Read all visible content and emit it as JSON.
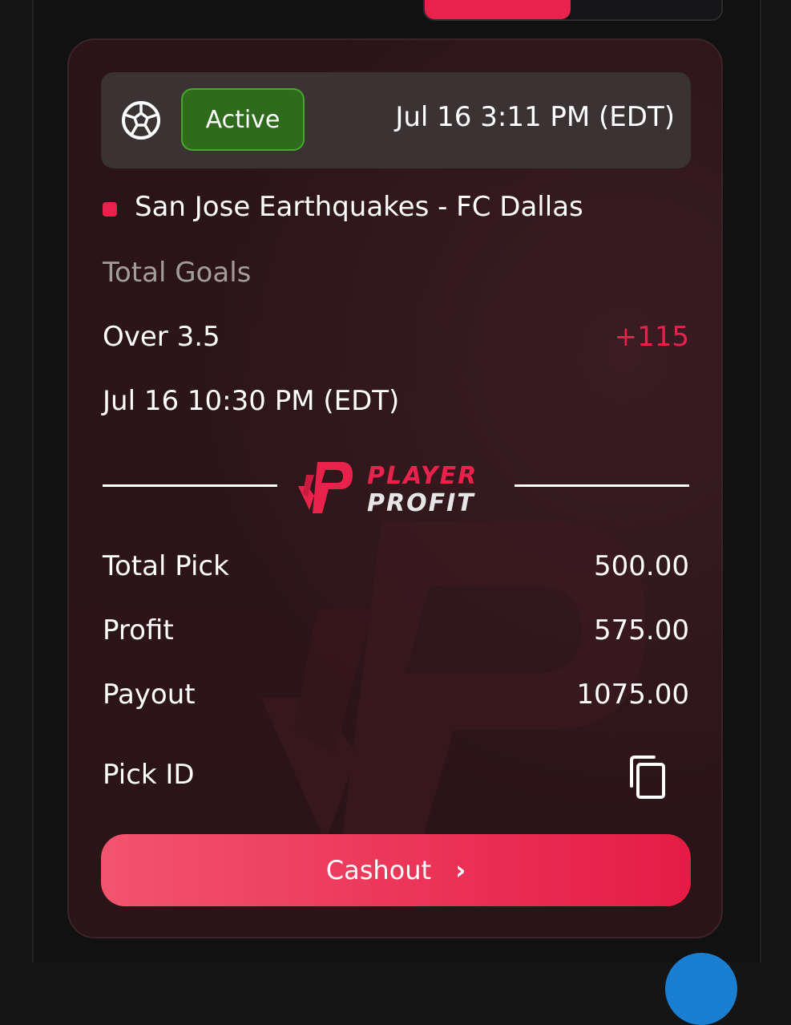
{
  "header": {
    "status": "Active",
    "placed_time": "Jul 16 3:11 PM (EDT)",
    "sport_icon": "soccer-ball-icon"
  },
  "event": {
    "match": "San Jose Earthquakes - FC Dallas",
    "market": "Total Goals",
    "selection": "Over 3.5",
    "odds": "+115",
    "start_time": "Jul 16 10:30 PM (EDT)"
  },
  "brand": {
    "line1": "PLAYER",
    "line2": "PROFIT"
  },
  "summary": {
    "total_pick_label": "Total Pick",
    "total_pick_value": "500.00",
    "profit_label": "Profit",
    "profit_value": "575.00",
    "payout_label": "Payout",
    "payout_value": "1075.00",
    "pick_id_label": "Pick ID",
    "copy_icon": "copy-icon"
  },
  "actions": {
    "cashout_label": "Cashout"
  },
  "colors": {
    "accent": "#e8224b",
    "status_bg": "#2f6b1c",
    "status_border": "#46a82b",
    "card_bg": "#2b1418",
    "muted_text": "#a39c9e"
  }
}
